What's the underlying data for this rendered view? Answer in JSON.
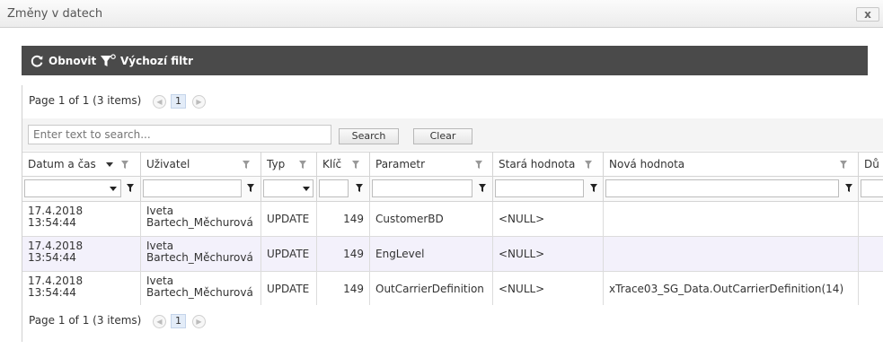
{
  "window": {
    "title": "Změny v datech",
    "close_label": "x"
  },
  "toolbar": {
    "refresh_label": "Obnovit",
    "default_filter_label": "Výchozí filtr"
  },
  "pager": {
    "summary": "Page 1 of 1 (3 items)",
    "current_page": "1"
  },
  "search": {
    "placeholder": "Enter text to search...",
    "value": "",
    "search_label": "Search",
    "clear_label": "Clear"
  },
  "columns": {
    "datetime": "Datum a čas",
    "user": "Uživatel",
    "type": "Typ",
    "key": "Klíč",
    "parameter": "Parametr",
    "old_value": "Stará hodnota",
    "new_value": "Nová hodnota",
    "extra": "Dů"
  },
  "rows": [
    {
      "date": "17.4.2018",
      "time": "13:54:44",
      "user_first": "Iveta",
      "user_last": "Bartech_Měchurová",
      "type": "UPDATE",
      "key": "149",
      "parameter": "CustomerBD",
      "old_value": "<NULL>",
      "new_value": ""
    },
    {
      "date": "17.4.2018",
      "time": "13:54:44",
      "user_first": "Iveta",
      "user_last": "Bartech_Měchurová",
      "type": "UPDATE",
      "key": "149",
      "parameter": "EngLevel",
      "old_value": "<NULL>",
      "new_value": ""
    },
    {
      "date": "17.4.2018",
      "time": "13:54:44",
      "user_first": "Iveta",
      "user_last": "Bartech_Měchurová",
      "type": "UPDATE",
      "key": "149",
      "parameter": "OutCarrierDefinition",
      "old_value": "<NULL>",
      "new_value": "xTrace03_SG_Data.OutCarrierDefinition(14)"
    }
  ],
  "colors": {
    "toolbar_bg": "#4a4a4a",
    "alt_row_bg": "#f3f1fb",
    "page_highlight": "#e3ecf8"
  },
  "icons": {
    "refresh": "refresh-icon",
    "funnel": "funnel-icon",
    "sort_desc": "sort-down-icon",
    "pager_prev": "chevron-left-icon",
    "pager_next": "chevron-right-icon"
  }
}
